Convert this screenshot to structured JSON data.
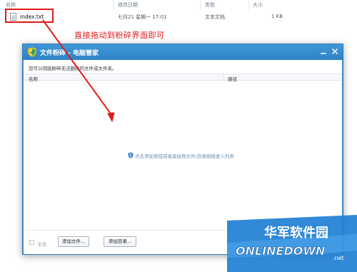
{
  "explorer": {
    "columns": {
      "name": "名称",
      "modified": "修改日期",
      "type": "类型",
      "size": "大小"
    },
    "file": {
      "name": "index.txt",
      "modified": "七月21 星期一 17:01",
      "type": "文本文档",
      "size": "1 KB"
    }
  },
  "annotation": {
    "text": "直接拖动到粉碎界面即可",
    "color": "#e21a1a"
  },
  "dialog": {
    "title": "文件粉碎 - 电脑管家",
    "hint": "您可以彻底粉碎无法删除的文件或文件夹。",
    "list_header": {
      "name": "名称",
      "path": "路径"
    },
    "drop_message": "点击添加按钮或者直接拖文件/目录拖拽进入列表",
    "select_all_label": "全选",
    "add_file_label": "添加文件...",
    "add_folder_label": "添加目录...",
    "titlebar_color": "#3a8fd0"
  },
  "watermark": {
    "line1": "华军软件园",
    "line2": "ONLINEDOWN",
    "suffix": ".net"
  }
}
